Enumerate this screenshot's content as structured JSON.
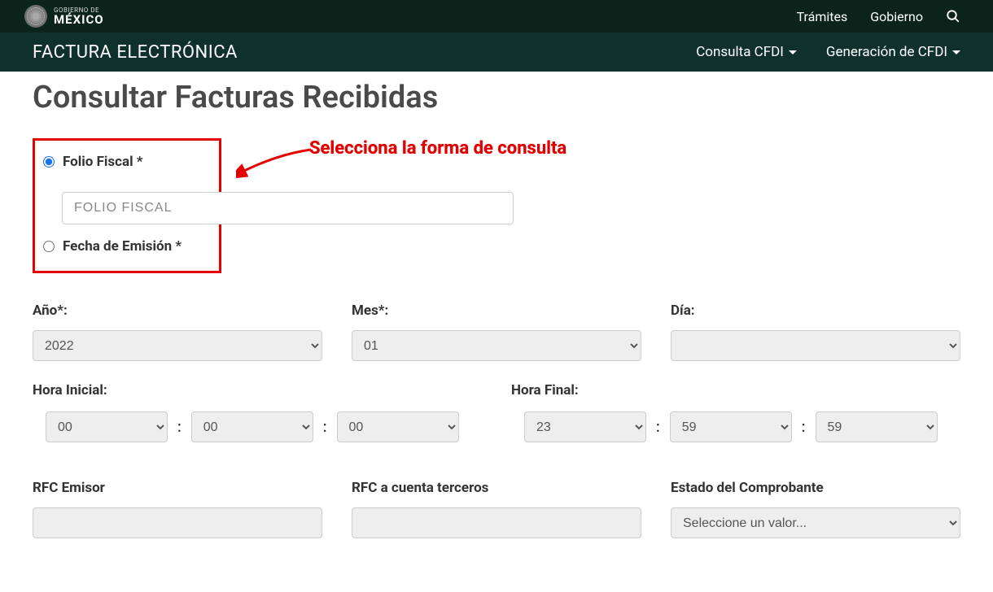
{
  "gob_header": {
    "line1": "GOBIERNO DE",
    "line2": "MÉXICO",
    "nav": {
      "tramites": "Trámites",
      "gobierno": "Gobierno"
    }
  },
  "app_nav": {
    "title": "FACTURA ELECTRÓNICA",
    "menu": {
      "consulta": "Consulta CFDI",
      "generacion": "Generación de CFDI"
    }
  },
  "page": {
    "title": "Consultar Facturas Recibidas",
    "annotation": "Selecciona la forma de consulta",
    "radio_folio": "Folio Fiscal *",
    "radio_fecha": "Fecha de Emisión *",
    "folio_placeholder": "FOLIO FISCAL"
  },
  "date": {
    "anio_label": "Año*:",
    "mes_label": "Mes*:",
    "dia_label": "Día:",
    "anio_value": "2022",
    "mes_value": "01",
    "dia_value": ""
  },
  "time": {
    "inicial_label": "Hora Inicial:",
    "final_label": "Hora Final:",
    "hi_h": "00",
    "hi_m": "00",
    "hi_s": "00",
    "hf_h": "23",
    "hf_m": "59",
    "hf_s": "59",
    "sep": ":"
  },
  "bottom": {
    "rfc_emisor_label": "RFC Emisor",
    "rfc_terceros_label": "RFC a cuenta terceros",
    "estado_label": "Estado del Comprobante",
    "estado_placeholder": "Seleccione un valor..."
  }
}
